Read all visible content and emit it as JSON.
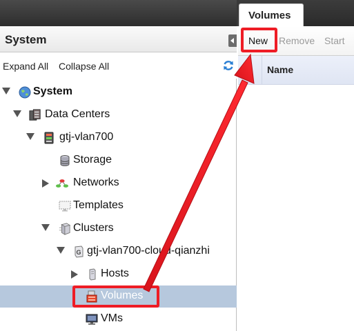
{
  "left_panel": {
    "title": "System",
    "toolbar": {
      "expand_all": "Expand All",
      "collapse_all": "Collapse All"
    },
    "tree": [
      {
        "label": "System",
        "icon": "globe-icon",
        "expander": "down",
        "bold": true
      },
      {
        "label": "Data Centers",
        "icon": "datacenter-icon",
        "expander": "down"
      },
      {
        "label": "gtj-vlan700",
        "icon": "server-rack-icon",
        "expander": "down"
      },
      {
        "label": "Storage",
        "icon": "storage-icon",
        "expander": "none"
      },
      {
        "label": "Networks",
        "icon": "network-icon",
        "expander": "right"
      },
      {
        "label": "Templates",
        "icon": "template-icon",
        "expander": "none"
      },
      {
        "label": "Clusters",
        "icon": "cluster-icon",
        "expander": "down"
      },
      {
        "label": "gtj-vlan700-cloud-qianzhi",
        "icon": "gluster-icon",
        "expander": "down"
      },
      {
        "label": "Hosts",
        "icon": "host-icon",
        "expander": "right"
      },
      {
        "label": "Volumes",
        "icon": "volume-icon",
        "expander": "none",
        "selected": true
      },
      {
        "label": "VMs",
        "icon": "vm-icon",
        "expander": "none"
      }
    ]
  },
  "right_panel": {
    "tab": "Volumes",
    "actions": [
      {
        "label": "New",
        "enabled": true
      },
      {
        "label": "Remove",
        "enabled": false
      },
      {
        "label": "Start",
        "enabled": false
      }
    ],
    "grid_columns": [
      "Name"
    ]
  },
  "annotations": {
    "highlight_color": "#ee1c25",
    "arrow_color": "#ee1c25"
  }
}
